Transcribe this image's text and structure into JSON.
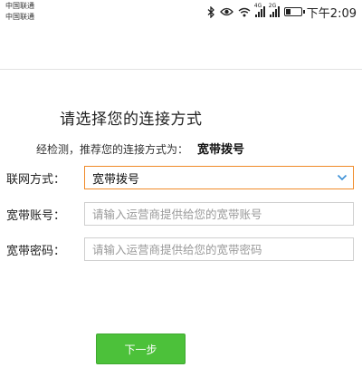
{
  "status_bar": {
    "carrier_1": "中国联通",
    "carrier_2": "中国联通",
    "signal_1_tag": "4G",
    "signal_2_tag": "2G",
    "time": "下午2:09",
    "icons": [
      "bluetooth-icon",
      "eye-icon",
      "wifi-icon",
      "signal-icon",
      "signal-icon",
      "battery-icon"
    ]
  },
  "wizard": {
    "title": "请选择您的连接方式",
    "detect_prefix": "经检测，推荐您的连接方式为：",
    "detected_method": "宽带拨号"
  },
  "form": {
    "connection": {
      "label": "联网方式：",
      "value": "宽带拨号"
    },
    "account": {
      "label": "宽带账号：",
      "placeholder": "请输入运营商提供给您的宽带账号"
    },
    "password": {
      "label": "宽带密码：",
      "placeholder": "请输入运营商提供给您的宽带密码"
    }
  },
  "actions": {
    "next_label": "下一步"
  },
  "colors": {
    "accent_orange": "#f08a28",
    "button_green": "#4cc13a",
    "chevron_blue": "#3a8fd6"
  }
}
